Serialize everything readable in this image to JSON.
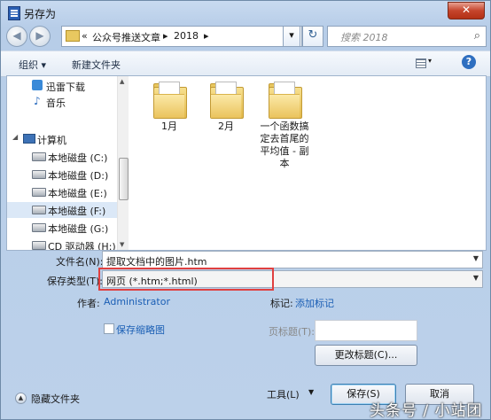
{
  "window": {
    "title": "另存为",
    "close_glyph": "✕"
  },
  "nav": {
    "back_glyph": "◀",
    "forward_glyph": "▶",
    "breadcrumb": [
      "«",
      "公众号推送文章",
      "▸",
      "2018",
      "▸"
    ],
    "search_placeholder": "搜索 2018"
  },
  "toolbar": {
    "organize": "组织 ▾",
    "new_folder": "新建文件夹",
    "help": "?"
  },
  "sidebar": {
    "items": [
      {
        "label": "迅雷下载",
        "icon": "download-icon"
      },
      {
        "label": "音乐",
        "icon": "music-icon"
      },
      {
        "label": "计算机",
        "icon": "computer-icon"
      },
      {
        "label": "本地磁盘 (C:)",
        "icon": "drive-icon"
      },
      {
        "label": "本地磁盘 (D:)",
        "icon": "drive-icon"
      },
      {
        "label": "本地磁盘 (E:)",
        "icon": "drive-icon"
      },
      {
        "label": "本地磁盘 (F:)",
        "icon": "drive-icon",
        "selected": true
      },
      {
        "label": "本地磁盘 (G:)",
        "icon": "drive-icon"
      },
      {
        "label": "CD 驱动器 (H:)",
        "icon": "cd-icon"
      }
    ]
  },
  "files": [
    {
      "name": "1月"
    },
    {
      "name": "2月"
    },
    {
      "name": "一个函数搞定去首尾的平均值 - 副本"
    }
  ],
  "form": {
    "filename_label": "文件名(N):",
    "filename_value": "提取文档中的图片.htm",
    "type_label": "保存类型(T):",
    "type_value": "网页 (*.htm;*.html)",
    "author_label": "作者:",
    "author_value": "Administrator",
    "tags_label": "标记:",
    "tags_value": "添加标记",
    "thumbnail_label": "保存缩略图",
    "page_title_label": "页标题(T):",
    "change_title_button": "更改标题(C)...",
    "tools_label": "工具(L)",
    "save_button": "保存(S)",
    "cancel_button": "取消",
    "hide_folders": "隐藏文件夹"
  },
  "watermark": "头条号 / 小站团"
}
